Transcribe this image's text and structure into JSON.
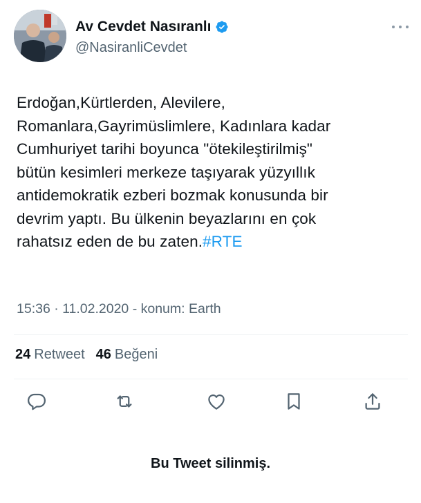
{
  "author": {
    "display_name": "Av Cevdet Nasıranlı",
    "handle": "@NasiranliCevdet",
    "verified_icon": "verified-badge-icon",
    "avatar_icon": "profile-photo"
  },
  "tweet": {
    "text": "Erdoğan,Kürtlerden, Alevilere,\nRomanlara,Gayrimüslimlere, Kadınlara kadar\nCumhuriyet tarihi boyunca \"ötekileştirilmiş\"\nbütün kesimleri merkeze taşıyarak yüzyıllık\nantidemokratik ezberi bozmak konusunda bir\ndevrim yaptı. Bu ülkenin beyazlarını en çok\nrahatsız eden de bu zaten.",
    "hashtag": "#RTE"
  },
  "meta": {
    "timestamp": "15:36 · 11.02.2020 - konum: Earth"
  },
  "stats": {
    "retweet_count": "24",
    "retweet_label": "Retweet",
    "like_count": "46",
    "like_label": "Beğeni"
  },
  "actions": [
    "reply-icon",
    "retweet-icon",
    "like-icon",
    "bookmark-icon",
    "share-icon"
  ],
  "footer": {
    "deleted_notice": "Bu Tweet silinmiş."
  },
  "colors": {
    "accent": "#1d9bf0",
    "text": "#0f1419",
    "secondary": "#536471",
    "divider": "#eff3f4"
  }
}
